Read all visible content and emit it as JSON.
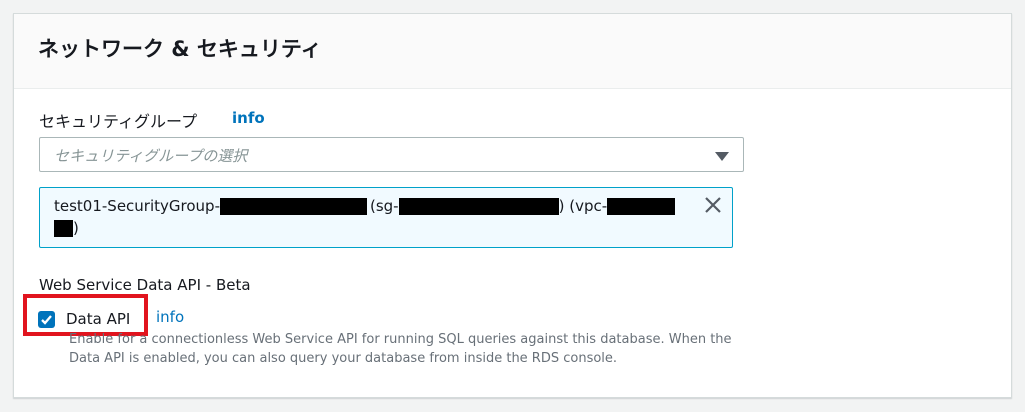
{
  "panel": {
    "title": "ネットワーク & セキュリティ"
  },
  "security_group": {
    "label": "セキュリティグループ",
    "info_link": "info",
    "select_placeholder": "セキュリティグループの選択",
    "selected_token": {
      "name_prefix": "test01-SecurityGroup-",
      "sg_prefix": "(sg-",
      "vpc_prefix": ") (vpc-",
      "close_paren": ")"
    }
  },
  "data_api": {
    "section_label": "Web Service Data API - Beta",
    "checkbox_label": "Data API",
    "checked": true,
    "info_link": "info",
    "description": "Enable for a connectionless Web Service API for running SQL queries against this database. When the Data API is enabled, you can also query your database from inside the RDS console."
  },
  "colors": {
    "link": "#0073bb",
    "token_border": "#00a1c9",
    "token_background": "#f1faff",
    "highlight": "#e1141e"
  }
}
